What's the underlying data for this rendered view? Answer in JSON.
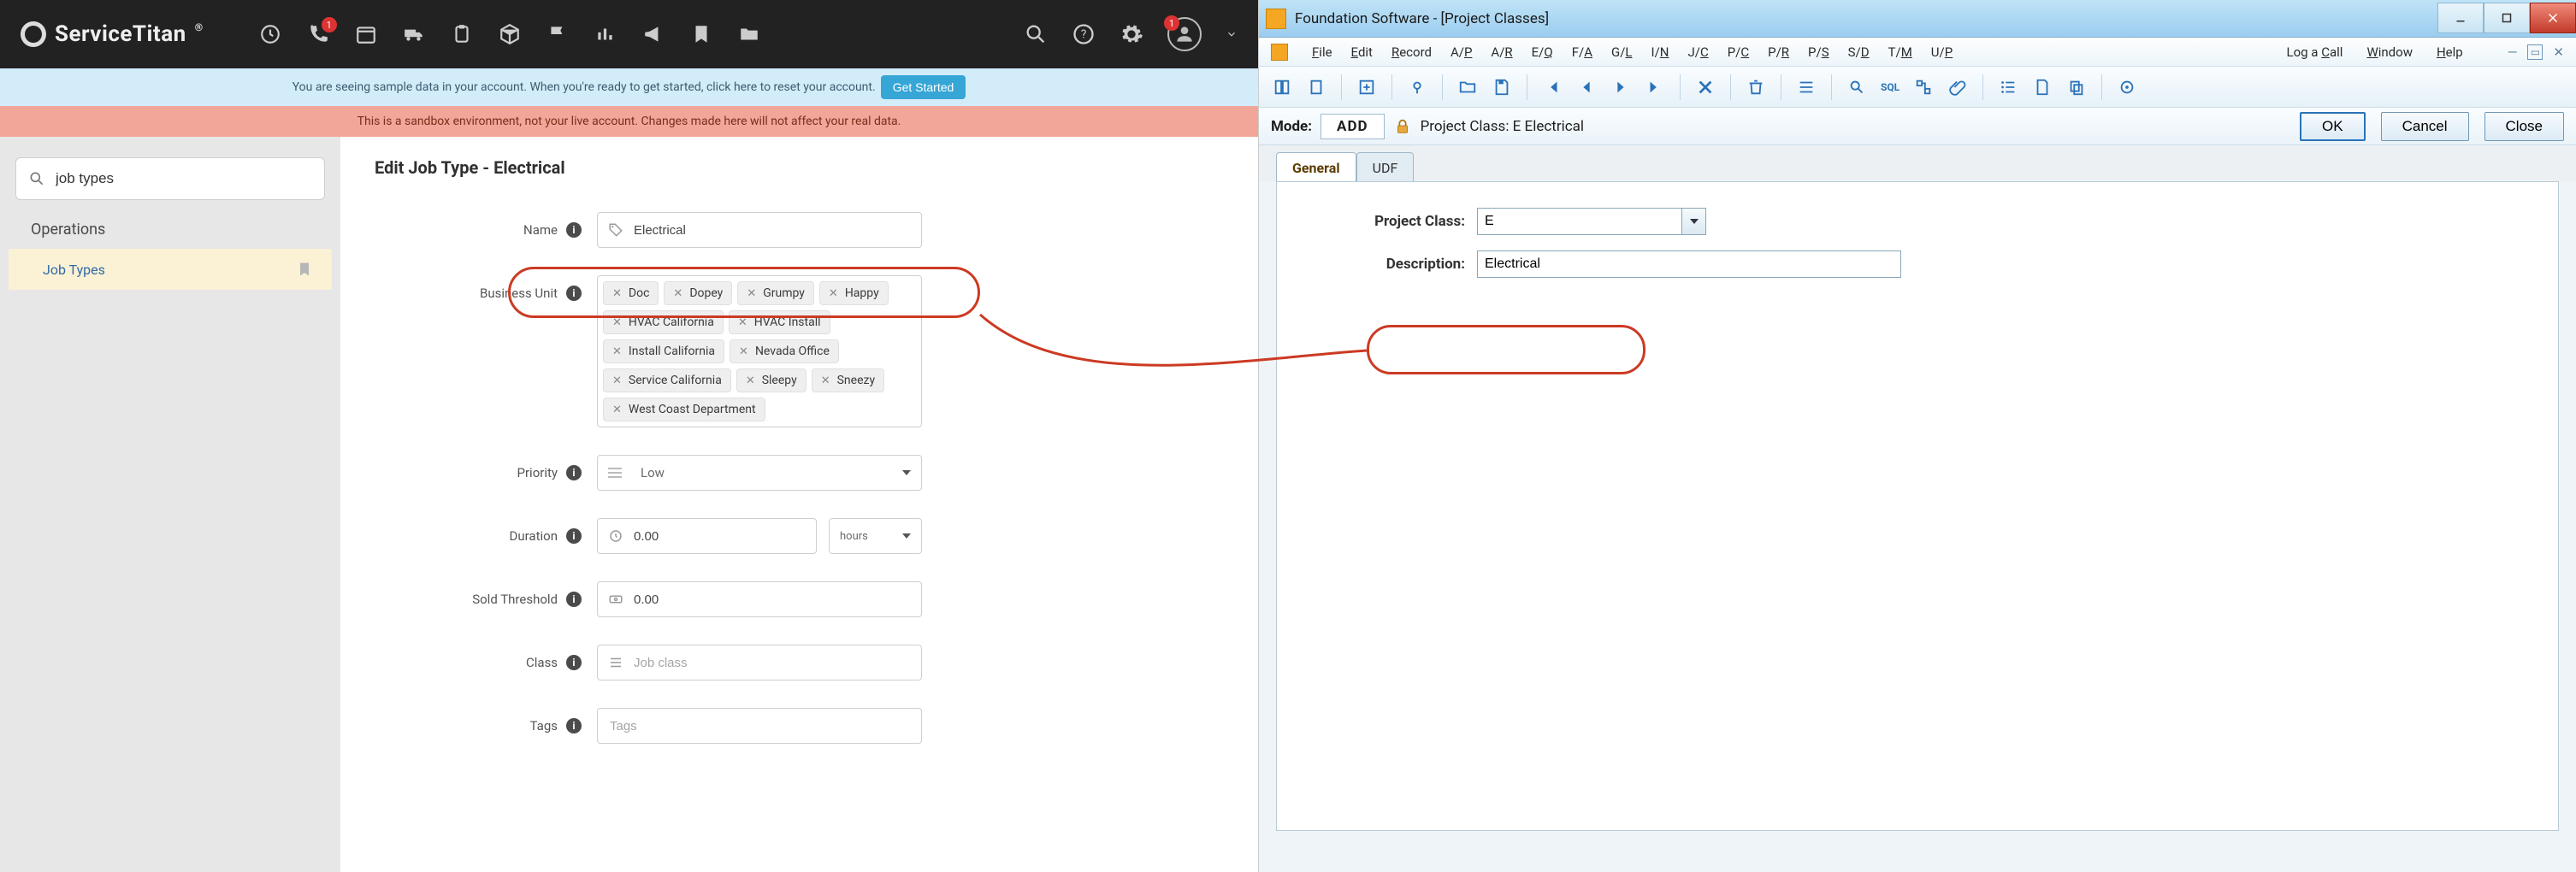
{
  "left": {
    "brand": "ServiceTitan",
    "topbar_badges": {
      "phone": "1",
      "avatar": "1"
    },
    "banner1_text": "You are seeing sample data in your account. When you're ready to get started, click here to reset your account.",
    "banner1_button": "Get Started",
    "banner2_text": "This is a sandbox environment, not your live account. Changes made here will not affect your real data.",
    "search_value": "job types",
    "sidebar_section": "Operations",
    "sidebar_item": "Job Types",
    "page_title": "Edit Job Type - Electrical",
    "labels": {
      "name": "Name",
      "business_unit": "Business Unit",
      "priority": "Priority",
      "duration": "Duration",
      "sold_threshold": "Sold Threshold",
      "class": "Class",
      "tags": "Tags"
    },
    "name_value": "Electrical",
    "business_units": [
      "Doc",
      "Dopey",
      "Grumpy",
      "Happy",
      "HVAC California",
      "HVAC Install",
      "Install California",
      "Nevada Office",
      "Service California",
      "Sleepy",
      "Sneezy",
      "West Coast Department"
    ],
    "priority_value": "Low",
    "duration_value": "0.00",
    "duration_unit": "hours",
    "sold_threshold_value": "0.00",
    "class_placeholder": "Job class",
    "tags_placeholder": "Tags"
  },
  "right": {
    "window_title": "Foundation Software - [Project Classes]",
    "menus": [
      "File",
      "Edit",
      "Record",
      "A/P",
      "A/R",
      "E/Q",
      "F/A",
      "G/L",
      "I/N",
      "J/C",
      "P/C",
      "P/R",
      "P/S",
      "S/D",
      "T/M",
      "U/P"
    ],
    "menus_right": [
      "Log a Call",
      "Window",
      "Help"
    ],
    "mode_label": "Mode:",
    "mode_value": "ADD",
    "context_label": "Project Class: E  Electrical",
    "buttons": {
      "ok": "OK",
      "cancel": "Cancel",
      "close": "Close"
    },
    "tabs": [
      "General",
      "UDF"
    ],
    "field_project_class_label": "Project Class:",
    "field_project_class_value": "E",
    "field_description_label": "Description:",
    "field_description_value": "Electrical"
  }
}
